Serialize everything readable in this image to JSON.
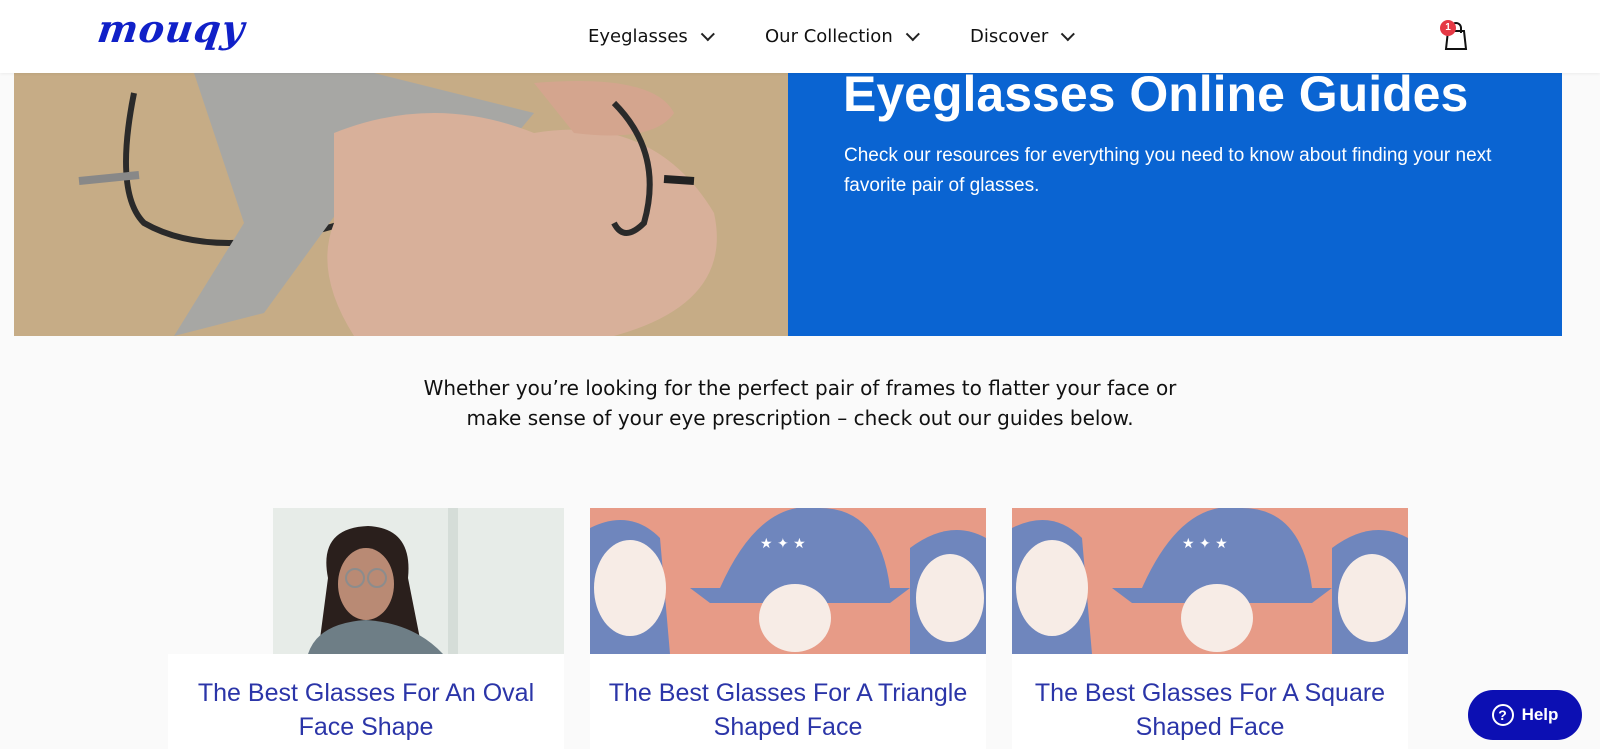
{
  "brand": {
    "logo_text": "mouqy",
    "logo_color": "#1020c8"
  },
  "nav": {
    "eyeglasses": "Eyeglasses",
    "collection": "Our Collection",
    "discover": "Discover"
  },
  "cart": {
    "count": "1"
  },
  "hero": {
    "title": "Eyeglasses Online Guides",
    "subtitle": "Check our resources for everything you need to know about finding your next favorite pair of glasses.",
    "bg_color": "#0a64d2"
  },
  "intro": {
    "line1": "Whether you’re looking for the perfect pair of frames to flatter your face or",
    "line2": "make sense of your eye prescription – check out our guides below."
  },
  "cards": [
    {
      "title": "The Best Glasses For An Oval Face Shape"
    },
    {
      "title": "The Best Glasses For A Triangle Shaped Face"
    },
    {
      "title": "The Best Glasses For A Square Shaped Face"
    }
  ],
  "help": {
    "label": "Help"
  }
}
